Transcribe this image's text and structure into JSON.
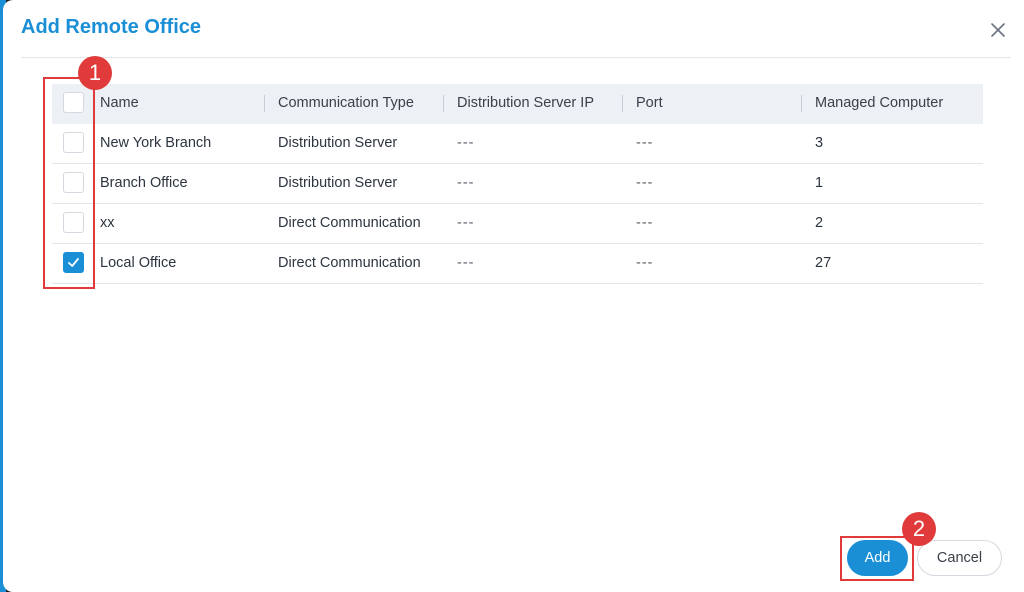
{
  "dialog": {
    "title": "Add Remote Office",
    "close_icon": "close-icon"
  },
  "table": {
    "headers": {
      "name": "Name",
      "communication_type": "Communication Type",
      "distribution_server_ip": "Distribution Server IP",
      "port": "Port",
      "managed_computer": "Managed Computer"
    },
    "rows": [
      {
        "checked": false,
        "name": "New York Branch",
        "communication_type": "Distribution Server",
        "distribution_server_ip": "---",
        "port": "---",
        "managed_computer": "3"
      },
      {
        "checked": false,
        "name": "Branch Office",
        "communication_type": "Distribution Server",
        "distribution_server_ip": "---",
        "port": "---",
        "managed_computer": "1"
      },
      {
        "checked": false,
        "name": "xx",
        "communication_type": "Direct Communication",
        "distribution_server_ip": "---",
        "port": "---",
        "managed_computer": "2"
      },
      {
        "checked": true,
        "name": "Local Office",
        "communication_type": "Direct Communication",
        "distribution_server_ip": "---",
        "port": "---",
        "managed_computer": "27"
      }
    ]
  },
  "annotations": {
    "step1": "1",
    "step2": "2"
  },
  "footer": {
    "add_label": "Add",
    "cancel_label": "Cancel"
  },
  "colors": {
    "accent": "#1a8fd6",
    "annotation_red": "#e03a3a"
  }
}
